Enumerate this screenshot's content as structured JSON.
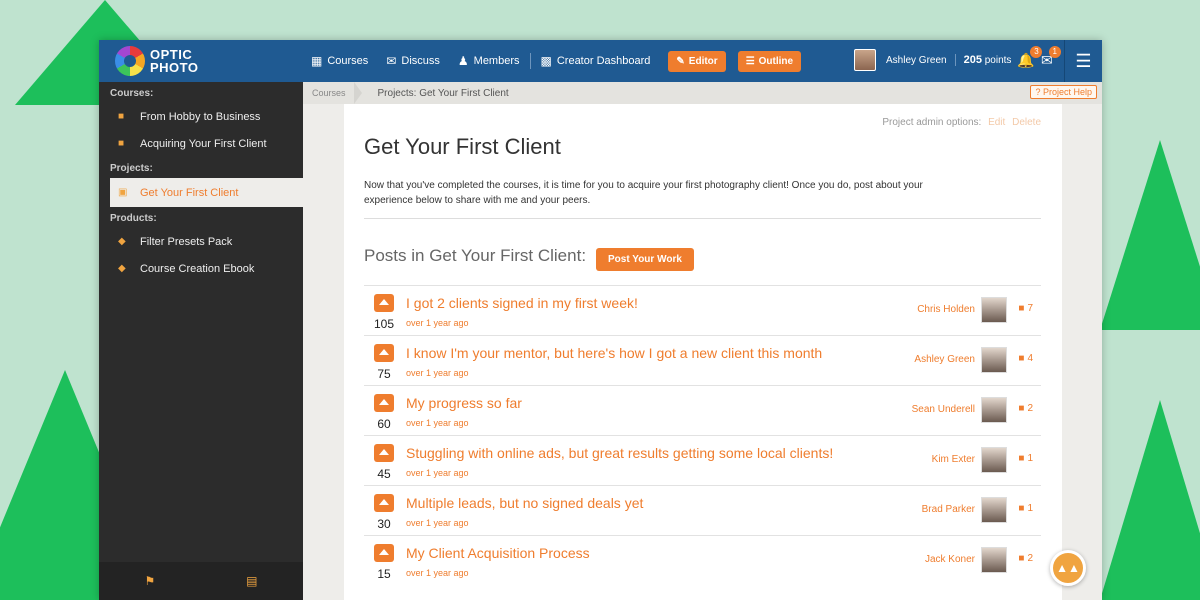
{
  "logo": {
    "line1": "OPTIC",
    "line2": "PHOTO"
  },
  "nav": {
    "courses": "Courses",
    "discuss": "Discuss",
    "members": "Members",
    "creator_dashboard": "Creator Dashboard",
    "editor": "Editor",
    "outline": "Outline"
  },
  "user": {
    "name": "Ashley Green",
    "points": "205",
    "points_label": "points",
    "notif_count": "3",
    "message_count": "1"
  },
  "sidebar": {
    "courses_head": "Courses:",
    "courses": [
      "From Hobby to Business",
      "Acquiring Your First Client"
    ],
    "projects_head": "Projects:",
    "projects": [
      "Get Your First Client"
    ],
    "products_head": "Products:",
    "products": [
      "Filter Presets Pack",
      "Course Creation Ebook"
    ]
  },
  "breadcrumb": {
    "root": "Courses",
    "current": "Projects: Get Your First Client",
    "help": "Project Help"
  },
  "project": {
    "admin_label": "Project admin options:",
    "edit": "Edit",
    "delete": "Delete",
    "title": "Get Your First Client",
    "description": "Now that you've completed the courses, it is time for you to acquire your first photography client! Once you do, post about your experience below to share with me and your peers.",
    "posts_heading": "Posts in Get Your First Client:",
    "post_button": "Post Your Work"
  },
  "posts": [
    {
      "votes": "105",
      "title": "I got 2 clients signed in my first week!",
      "date": "over 1 year ago",
      "author": "Chris Holden",
      "comments": "7"
    },
    {
      "votes": "75",
      "title": "I know I'm your mentor, but here's how I got a new client this month",
      "date": "over 1 year ago",
      "author": "Ashley Green",
      "comments": "4"
    },
    {
      "votes": "60",
      "title": "My progress so far",
      "date": "over 1 year ago",
      "author": "Sean Underell",
      "comments": "2"
    },
    {
      "votes": "45",
      "title": "Stuggling with online ads, but great results getting some local clients!",
      "date": "over 1 year ago",
      "author": "Kim Exter",
      "comments": "1"
    },
    {
      "votes": "30",
      "title": "Multiple leads, but no signed deals yet",
      "date": "over 1 year ago",
      "author": "Brad Parker",
      "comments": "1"
    },
    {
      "votes": "15",
      "title": "My Client Acquisition Process",
      "date": "over 1 year ago",
      "author": "Jack Koner",
      "comments": "2"
    }
  ],
  "colors": {
    "accent": "#ef7d2e",
    "topbar": "#1f5a92",
    "sidebar": "#2c2c2c",
    "background": "#bfe3cf",
    "decor": "#1dbf5b"
  }
}
